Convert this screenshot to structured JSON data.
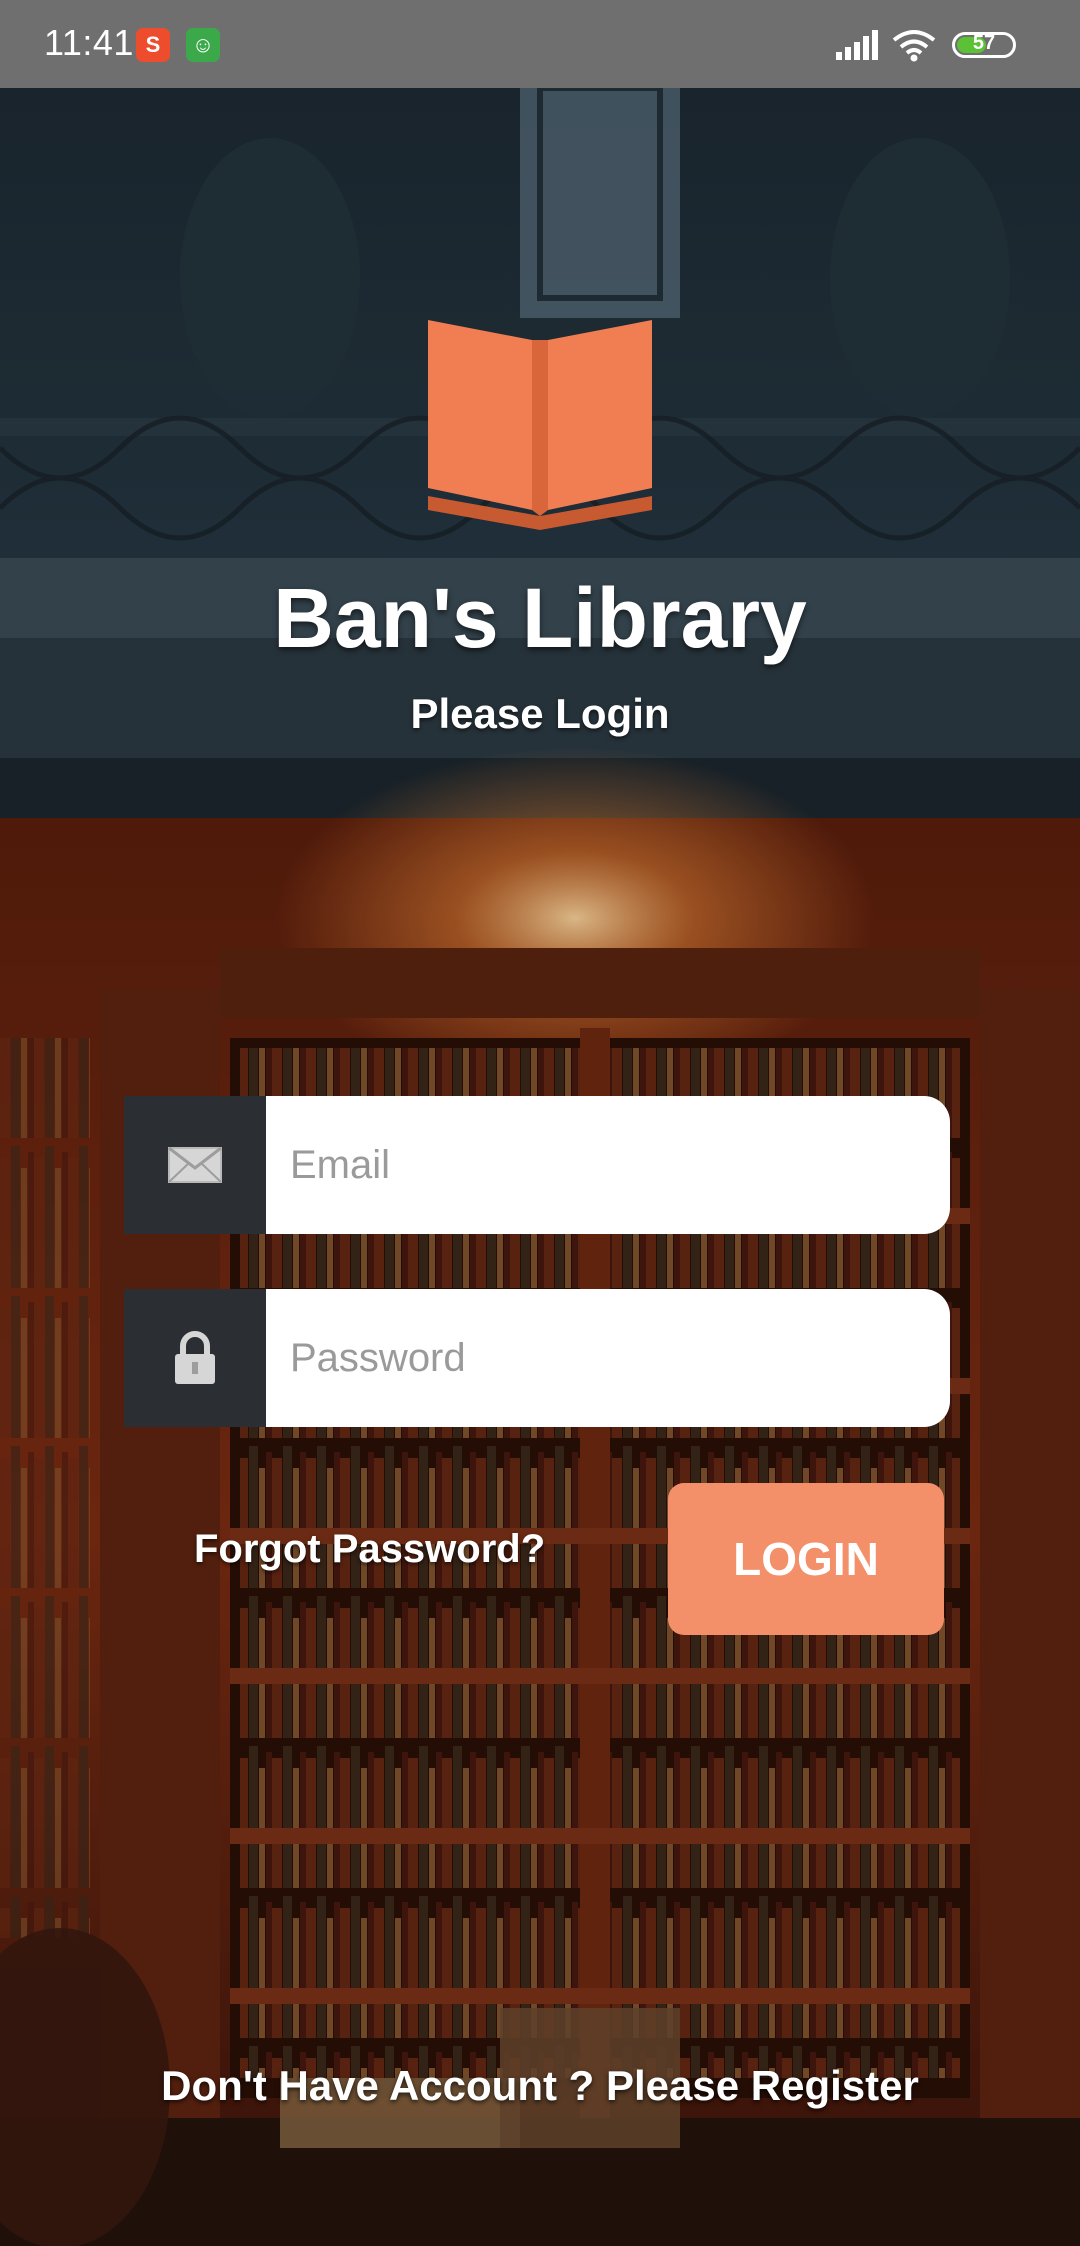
{
  "status_bar": {
    "time": "11:41",
    "battery_level": "57",
    "battery_fraction": 0.57,
    "icons": [
      "shopee-icon",
      "android-icon",
      "signal-icon",
      "wifi-icon",
      "battery-icon"
    ]
  },
  "header": {
    "logo_icon": "open-book-icon",
    "title": "Ban's Library",
    "subtitle": "Please Login"
  },
  "form": {
    "email": {
      "icon": "envelope-icon",
      "placeholder": "Email",
      "value": ""
    },
    "password": {
      "icon": "lock-icon",
      "placeholder": "Password",
      "value": ""
    },
    "forgot_label": "Forgot Password?",
    "login_label": "LOGIN"
  },
  "footer": {
    "register_label": "Don't Have Account ? Please Register"
  },
  "colors": {
    "accent": "#f3906a",
    "logo": "#f07e52",
    "icon_box": "#2b2e33",
    "status_bar": "#6f6f6f"
  }
}
